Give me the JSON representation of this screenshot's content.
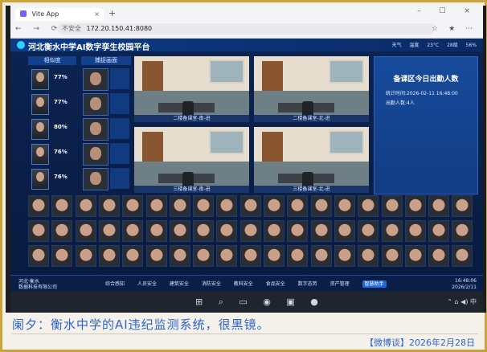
{
  "browser": {
    "tab_title": "Vite App",
    "tab_close": "×",
    "new_tab": "+",
    "window_controls": "– ☐ ×",
    "nav_icons": "← → ⟳",
    "security_label": "不安全",
    "url": "172.20.150.41:8080",
    "toolbar_icons": "☆ ★ ⋯"
  },
  "app": {
    "title": "河北衡水中学AI数字孪生校园平台",
    "weather": [
      "天气",
      "温度",
      "23°C",
      "28级",
      "56%"
    ],
    "left_panel": {
      "col_similarity": "相似度",
      "col_capture": "捕捉画面",
      "rows": [
        {
          "similarity": "77%"
        },
        {
          "similarity": "77%"
        },
        {
          "similarity": "80%"
        },
        {
          "similarity": "76%"
        },
        {
          "similarity": "76%"
        }
      ]
    },
    "cameras": [
      {
        "label": "二楼备课室-南-进"
      },
      {
        "label": "二楼备课室-北-进"
      },
      {
        "label": "三楼备课室-南-进"
      },
      {
        "label": "三楼备课室-北-进"
      }
    ],
    "stats": {
      "title": "备课区今日出勤人数",
      "time": "统计时间:2026-02-11 16:48:00",
      "count": "出勤人数:4人"
    },
    "bottom": {
      "school_line1": "河北·衡水",
      "school_line2": "数据科技有限公司",
      "nav": [
        "综合感知",
        "人员安全",
        "建筑安全",
        "消防安全",
        "教科安全",
        "食品安全",
        "数字态势",
        "资产管理",
        "智慧助手"
      ],
      "clock_time": "16:48:06",
      "clock_date": "2026/2/11"
    }
  },
  "taskbar": {
    "icons": "⊞ ⌕ ▭ ◉ ▣ ●",
    "tray": "⌃ ⌂ ◀) 中"
  },
  "caption": "阑夕：衡水中学的AI违纪监测系统，很黑镜。",
  "source": "【微博谈】2026年2月28日"
}
